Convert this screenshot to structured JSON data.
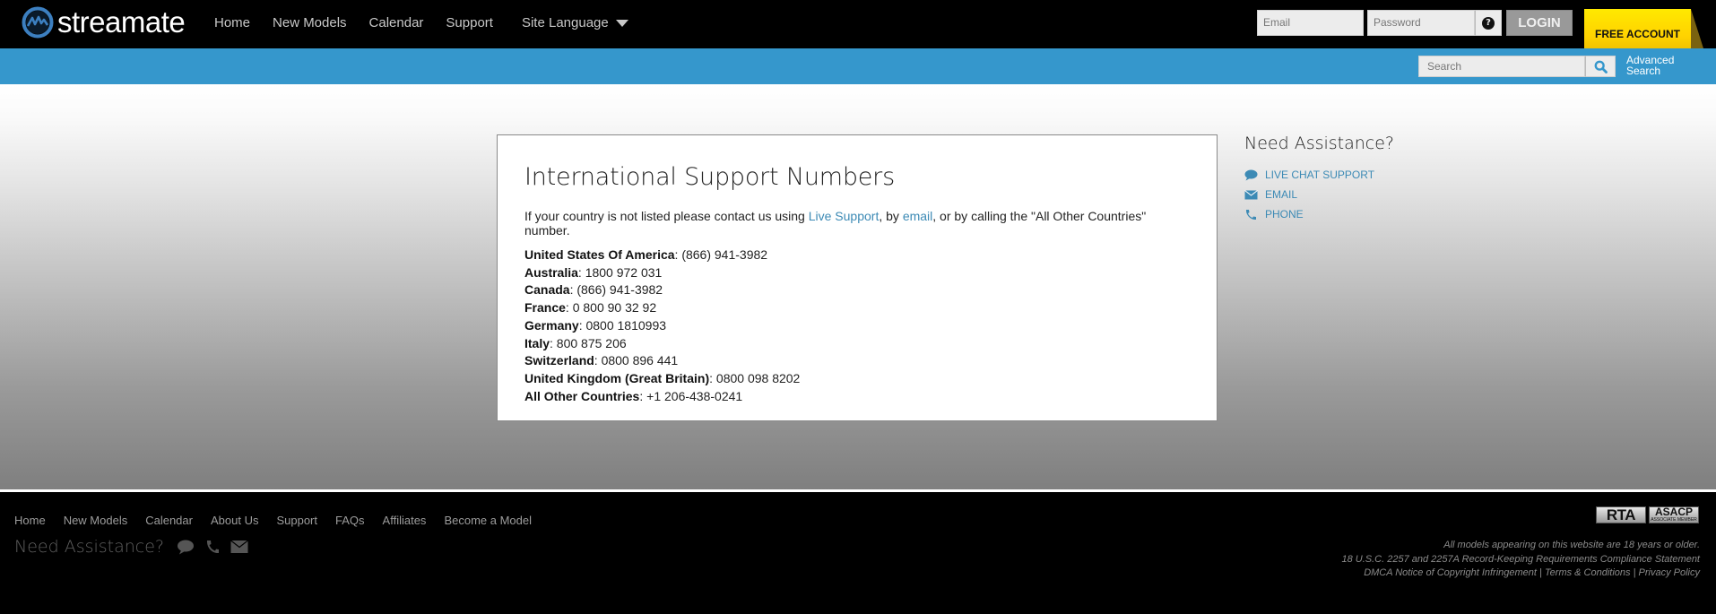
{
  "header": {
    "brand": "streamate",
    "nav": [
      {
        "label": "Home"
      },
      {
        "label": "New Models"
      },
      {
        "label": "Calendar"
      },
      {
        "label": "Support"
      }
    ],
    "language_label": "Site Language",
    "email_placeholder": "Email",
    "password_placeholder": "Password",
    "help_icon": "?",
    "login_label": "LOGIN",
    "free_account_label": "FREE ACCOUNT"
  },
  "searchbar": {
    "placeholder": "Search",
    "advanced_line1": "Advanced",
    "advanced_line2": "Search"
  },
  "main": {
    "title": "International Support Numbers",
    "intro": {
      "before": "If your country is not listed please contact us using ",
      "link1": "Live Support",
      "middle": ", by ",
      "link2": "email",
      "after": ", or by calling the \"All Other Countries\" number."
    },
    "numbers": [
      {
        "country": "United States Of America",
        "number": "(866) 941-3982"
      },
      {
        "country": "Australia",
        "number": "1800 972 031"
      },
      {
        "country": "Canada",
        "number": "(866) 941-3982"
      },
      {
        "country": "France",
        "number": "0 800 90 32 92"
      },
      {
        "country": "Germany",
        "number": "0800 1810993"
      },
      {
        "country": "Italy",
        "number": "800 875 206"
      },
      {
        "country": "Switzerland",
        "number": "0800 896 441"
      },
      {
        "country": "United Kingdom (Great Britain)",
        "number": "0800 098 8202"
      },
      {
        "country": "All Other Countries",
        "number": "+1 206-438-0241"
      }
    ]
  },
  "assistance": {
    "title": "Need Assistance?",
    "items": [
      {
        "label": "LIVE CHAT SUPPORT",
        "icon": "chat-bubble-icon"
      },
      {
        "label": "EMAIL",
        "icon": "envelope-icon"
      },
      {
        "label": "PHONE",
        "icon": "phone-icon"
      }
    ]
  },
  "footer": {
    "nav": [
      {
        "label": "Home"
      },
      {
        "label": "New Models"
      },
      {
        "label": "Calendar"
      },
      {
        "label": "About Us"
      },
      {
        "label": "Support"
      },
      {
        "label": "FAQs"
      },
      {
        "label": "Affiliates"
      },
      {
        "label": "Become a Model"
      }
    ],
    "assist_title": "Need Assistance?",
    "badges": {
      "rta": "RTA",
      "asacp": "ASACP",
      "asacp_sub": "ASSOCIATE MEMBER"
    },
    "legal_line1": "All models appearing on this website are 18 years or older.",
    "legal_line2": "18 U.S.C. 2257 and 2257A Record-Keeping Requirements Compliance Statement",
    "legal_links": [
      "DMCA Notice of Copyright Infringement",
      "Terms & Conditions",
      "Privacy Policy"
    ],
    "legal_sep": " | "
  },
  "colors": {
    "accent_blue": "#3597cc",
    "link_blue": "#3c8ab5",
    "free_account_yellow": "#ffe100",
    "login_gray": "#999999"
  }
}
